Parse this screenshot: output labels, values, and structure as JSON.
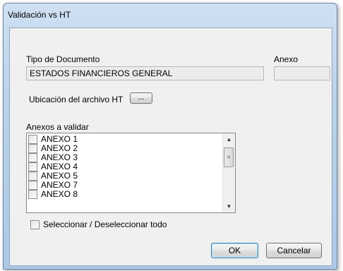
{
  "window": {
    "title": "Validación vs HT"
  },
  "form": {
    "tipo_label": "Tipo de Documento",
    "tipo_value": "ESTADOS FINANCIEROS GENERAL",
    "anexo_label": "Anexo",
    "anexo_value": "",
    "ubicacion_label": "Ubicación del archivo HT",
    "browse_label": "...",
    "anexos_label": "Anexos a validar",
    "select_all_label": "Seleccionar / Deseleccionar todo"
  },
  "anexos": [
    "ANEXO 1",
    "ANEXO 2",
    "ANEXO 3",
    "ANEXO 4",
    "ANEXO 5",
    "ANEXO 7",
    "ANEXO 8"
  ],
  "buttons": {
    "ok": "OK",
    "cancel": "Cancelar"
  },
  "icons": {
    "scroll_up": "scroll-up-arrow-icon",
    "scroll_down": "scroll-down-arrow-icon",
    "grip": "scroll-grip-icon"
  }
}
